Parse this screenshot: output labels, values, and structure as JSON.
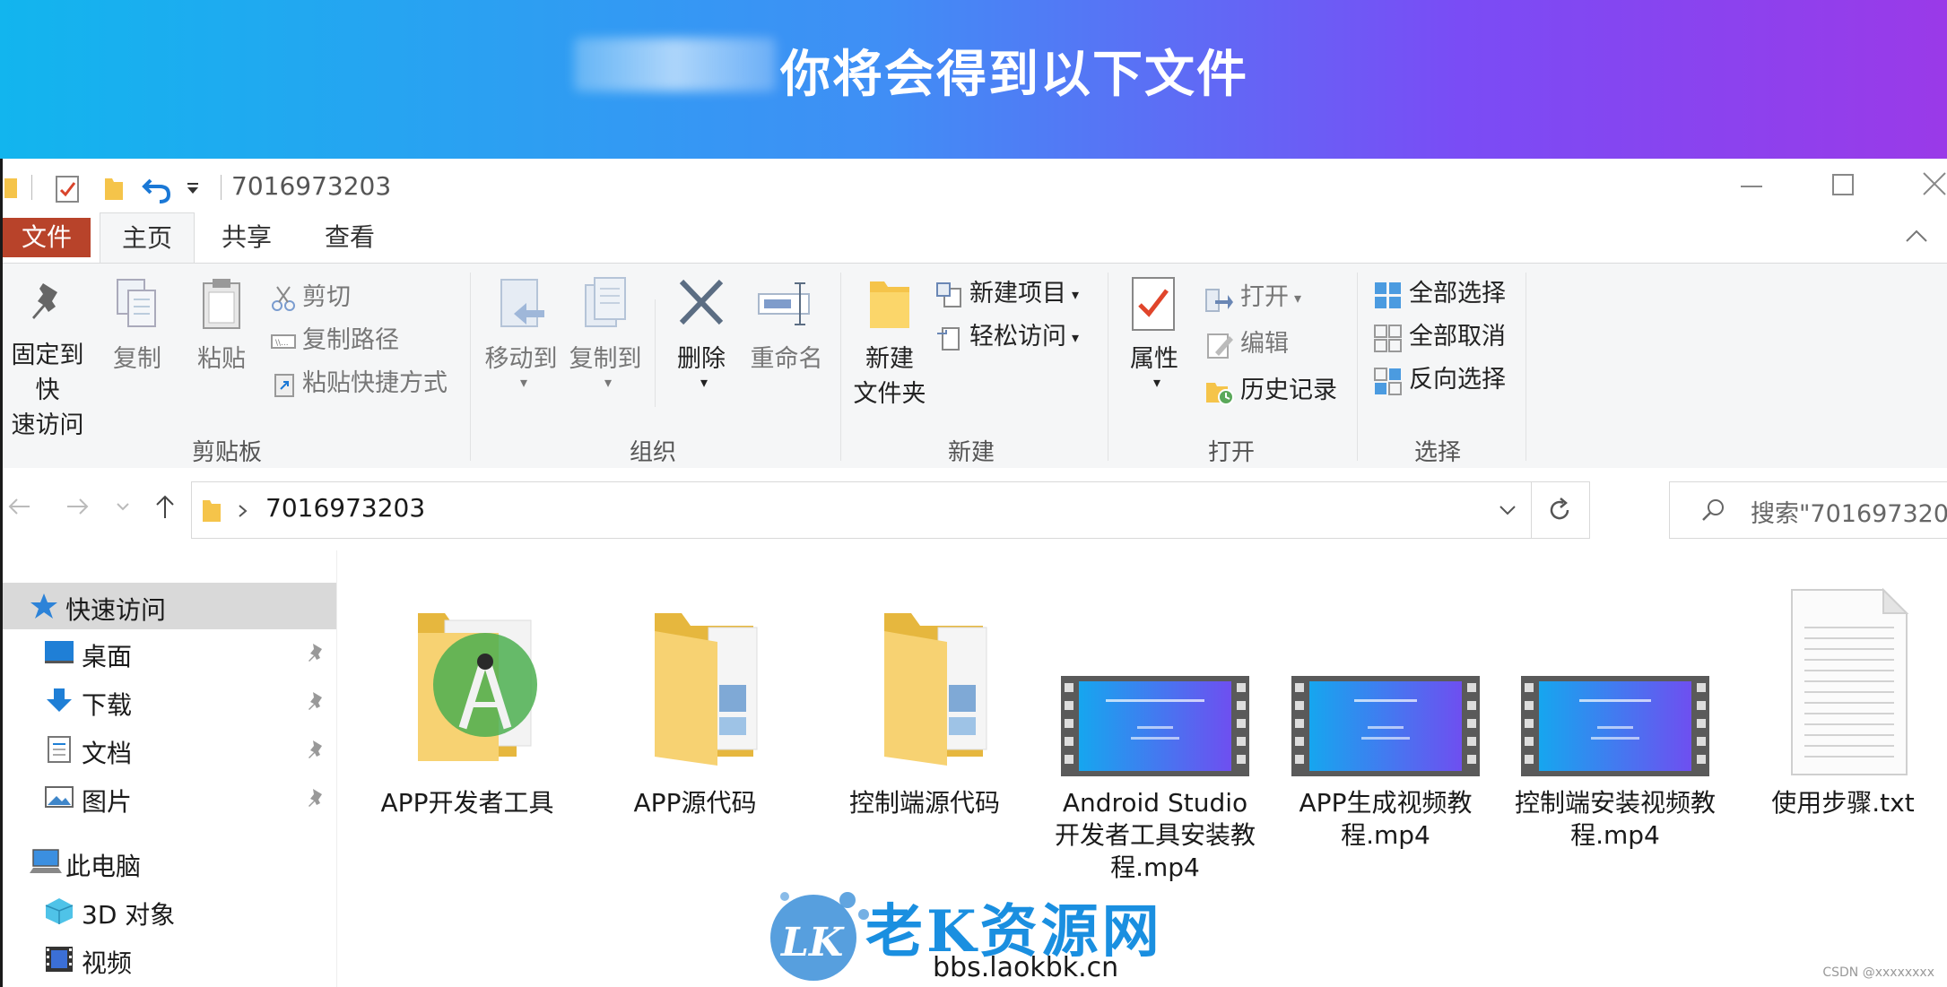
{
  "banner": {
    "title": "你将会得到以下文件"
  },
  "window": {
    "title": "7016973203",
    "colors": {
      "file_tab": "#b8432a",
      "selected": "#d9d9d9",
      "accent": "#1a78d6"
    }
  },
  "tabs": [
    "文件",
    "主页",
    "共享",
    "查看"
  ],
  "ribbon": {
    "clipboard": {
      "label": "剪贴板",
      "pin_line1": "固定到快",
      "pin_line2": "速访问",
      "copy": "复制",
      "paste": "粘贴",
      "cut": "剪切",
      "copy_path": "复制路径",
      "paste_shortcut": "粘贴快捷方式"
    },
    "organize": {
      "label": "组织",
      "move_to": "移动到",
      "copy_to": "复制到",
      "delete": "删除",
      "rename": "重命名"
    },
    "new": {
      "label": "新建",
      "new_folder_line1": "新建",
      "new_folder_line2": "文件夹",
      "new_item": "新建项目",
      "easy_access": "轻松访问"
    },
    "open": {
      "label": "打开",
      "properties": "属性",
      "open": "打开",
      "edit": "编辑",
      "history": "历史记录"
    },
    "select": {
      "label": "选择",
      "select_all": "全部选择",
      "select_none": "全部取消",
      "invert": "反向选择"
    }
  },
  "address": {
    "path": "7016973203",
    "search_placeholder": "搜索\"701697320..."
  },
  "sidebar": {
    "quick_access": "快速访问",
    "items": [
      {
        "label": "桌面",
        "icon": "desktop-icon"
      },
      {
        "label": "下载",
        "icon": "download-icon"
      },
      {
        "label": "文档",
        "icon": "document-icon"
      },
      {
        "label": "图片",
        "icon": "picture-icon"
      }
    ],
    "this_pc": "此电脑",
    "pc_items": [
      {
        "label": "3D 对象",
        "icon": "3d-object-icon"
      },
      {
        "label": "视频",
        "icon": "video-icon"
      }
    ]
  },
  "files": [
    {
      "name": "APP开发者工具",
      "type": "folder-android"
    },
    {
      "name": "APP源代码",
      "type": "folder"
    },
    {
      "name": "控制端源代码",
      "type": "folder"
    },
    {
      "name": "Android Studio开发者工具安装教程.mp4",
      "type": "video"
    },
    {
      "name": "APP生成视频教程.mp4",
      "type": "video"
    },
    {
      "name": "控制端安装视频教程.mp4",
      "type": "video"
    },
    {
      "name": "使用步骤.txt",
      "type": "text"
    }
  ],
  "watermark": {
    "title": "老K资源网",
    "url": "bbs.laokbk.cn",
    "logo_text": "LK"
  },
  "credit": "CSDN @xxxxxxxx"
}
